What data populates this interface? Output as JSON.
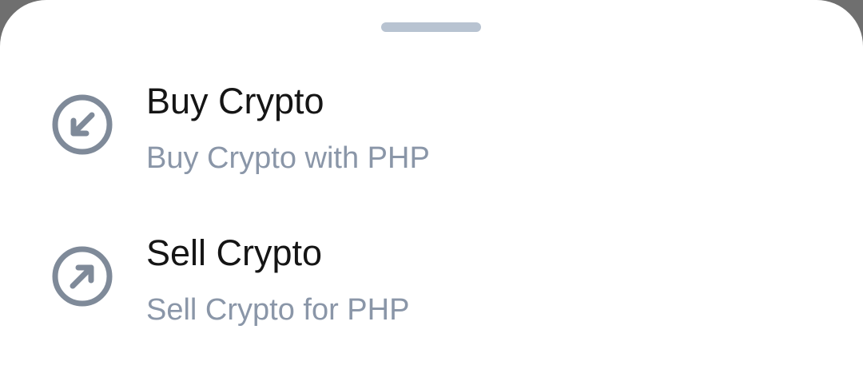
{
  "sheet": {
    "handle_color": "#b8c3d1",
    "options": [
      {
        "title": "Buy Crypto",
        "subtitle": "Buy Crypto with PHP",
        "icon": "arrow-down-left-circle-icon"
      },
      {
        "title": "Sell Crypto",
        "subtitle": "Sell Crypto for PHP",
        "icon": "arrow-up-right-circle-icon"
      }
    ]
  },
  "colors": {
    "title_text": "#151515",
    "subtitle_text": "#8a96a8",
    "icon_stroke": "#7f8a99",
    "sheet_background": "#ffffff",
    "backdrop": "#6f6f6f"
  }
}
